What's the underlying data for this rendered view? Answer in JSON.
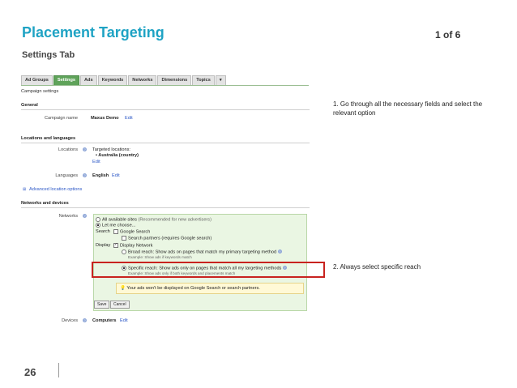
{
  "slide": {
    "title": "Placement Targeting",
    "page_count": "1 of 6",
    "subtitle": "Settings Tab",
    "page_number": "26",
    "callouts": [
      "1. Go through all the necessary fields and select the relevant option",
      "2. Always select specific reach"
    ]
  },
  "screenshot": {
    "tabs": [
      {
        "label": "Ad Groups",
        "active": false
      },
      {
        "label": "Settings",
        "active": true
      },
      {
        "label": "Ads",
        "active": false
      },
      {
        "label": "Keywords",
        "active": false
      },
      {
        "label": "Networks",
        "active": false
      },
      {
        "label": "Dimensions",
        "active": false
      },
      {
        "label": "Topics",
        "active": false
      },
      {
        "label": "▾",
        "active": false
      }
    ],
    "heading": "Campaign settings",
    "general": {
      "section": "General",
      "campaign_name_label": "Campaign name",
      "campaign_name_value": "Maxus Demo",
      "edit": "Edit"
    },
    "locations": {
      "section": "Locations and languages",
      "locations_label": "Locations",
      "targeted_label": "Targeted locations:",
      "targeted_value": "• Australia (country)",
      "edit": "Edit",
      "languages_label": "Languages",
      "languages_value": "English",
      "advanced": "Advanced location options"
    },
    "networks": {
      "section": "Networks and devices",
      "networks_label": "Networks",
      "all_sites": "All available sites",
      "all_sites_note": "(Recommended for new advertisers)",
      "let_me_choose": "Let me choose...",
      "search_label": "Search",
      "google_search": "Google Search",
      "search_partners": "Search partners (requires Google search)",
      "display_label": "Display",
      "display_network": "Display Network",
      "broad_reach": "Broad reach: Show ads on pages that match my primary targeting method",
      "broad_example": "Example: Show ads if keywords match",
      "specific_reach": "Specific reach: Show ads only on pages that match all my targeting methods",
      "specific_example": "Example: Show ads only if both keywords and placements match",
      "warning": "Your ads won't be displayed on Google Search or search partners.",
      "save": "Save",
      "cancel": "Cancel",
      "devices_label": "Devices",
      "devices_value": "Computers",
      "edit": "Edit"
    }
  }
}
